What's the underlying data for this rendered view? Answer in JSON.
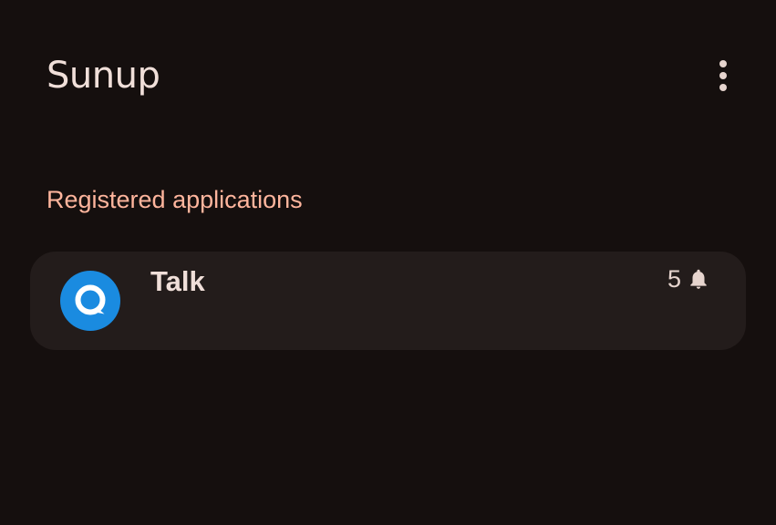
{
  "app": {
    "title": "Sunup"
  },
  "toolbar": {
    "menu_icon": "more-vert-icon"
  },
  "section": {
    "header": "Registered applications"
  },
  "applications": [
    {
      "name": "Talk",
      "icon": "nextcloud-talk-icon",
      "icon_color": "#1a8be0",
      "notification_count": "5",
      "notification_icon": "bell-icon"
    }
  ],
  "colors": {
    "background": "#150f0e",
    "card": "#231c1b",
    "accent": "#ffb59d",
    "text": "#f0dfd9"
  }
}
